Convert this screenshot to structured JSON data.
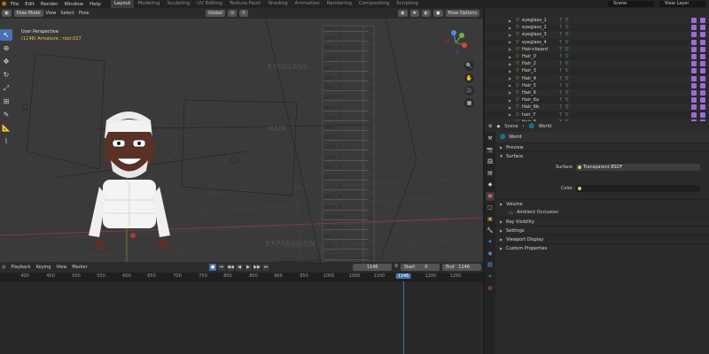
{
  "topbar": {
    "menu": [
      "File",
      "Edit",
      "Render",
      "Window",
      "Help"
    ],
    "tabs": [
      "Layout",
      "Modeling",
      "Sculpting",
      "UV Editing",
      "Texture Paint",
      "Shading",
      "Animation",
      "Rendering",
      "Compositing",
      "Scripting"
    ],
    "active_tab": "Layout",
    "scene": "Scene",
    "view_layer": "View Layer"
  },
  "viewport": {
    "mode": "Pose Mode",
    "menu": [
      "View",
      "Select",
      "Pose"
    ],
    "orientation": "Global",
    "pose_options": "Pose Options",
    "info_title": "User Perspective",
    "info_sub": "(1146) Armature : root.027",
    "overlay_labels": [
      "EYEGLASS",
      "HAIR",
      "EXPRESSION"
    ],
    "column_items": [
      "type_ 2",
      "type_ 3",
      "type_ 4",
      "type_ 5",
      "type_ 1",
      "type_ 2",
      "type_ 3",
      "type_ 4",
      "type_ 5",
      "type_ 0",
      "type_ 1",
      "type_ 2",
      "type_ 3",
      "type_ 4",
      "type_ 5",
      "type_ 6",
      "type_ 7",
      "type_ 8",
      "type_ 9",
      "type_ 10",
      "type_ 11",
      "type_ 12",
      "type_ 1",
      "type_ 2"
    ]
  },
  "timeline": {
    "menu": [
      "Playback",
      "Keying",
      "View",
      "Marker"
    ],
    "current_frame": "1146",
    "start_label": "Start",
    "start": "0",
    "end_label": "End",
    "end": "1146",
    "ruler": [
      "400",
      "450",
      "500",
      "550",
      "600",
      "650",
      "700",
      "750",
      "800",
      "850",
      "900",
      "950",
      "1000",
      "1050",
      "1100",
      "1146",
      "1200",
      "1250"
    ]
  },
  "outliner": {
    "rows": [
      {
        "name": "eyeglass_1"
      },
      {
        "name": "eyeglass_2"
      },
      {
        "name": "eyeglass_3"
      },
      {
        "name": "eyeglass_4"
      },
      {
        "name": "Hair+beard"
      },
      {
        "name": "Hair_0"
      },
      {
        "name": "Hair_2"
      },
      {
        "name": "Hair_3"
      },
      {
        "name": "Hair_4"
      },
      {
        "name": "Hair_5"
      },
      {
        "name": "Hair_6"
      },
      {
        "name": "Hair_6a"
      },
      {
        "name": "Hair_6b"
      },
      {
        "name": "hair_7"
      },
      {
        "name": "Hair_8"
      }
    ]
  },
  "properties": {
    "breadcrumb_scene": "Scene",
    "breadcrumb_world": "World",
    "world_name": "World",
    "sections": {
      "preview": "Preview",
      "surface": "Surface",
      "volume": "Volume",
      "ambient_occlusion": "Ambient Occlusion",
      "ray_visibility": "Ray Visibility",
      "settings": "Settings",
      "viewport_display": "Viewport Display",
      "custom_properties": "Custom Properties"
    },
    "surface_label": "Surface",
    "surface_value": "Transparent BSDF",
    "color_label": "Color"
  },
  "colors": {
    "accent": "#4772b3",
    "outliner_toggle": "#9d6bd6",
    "logo": "#e87d0d"
  }
}
